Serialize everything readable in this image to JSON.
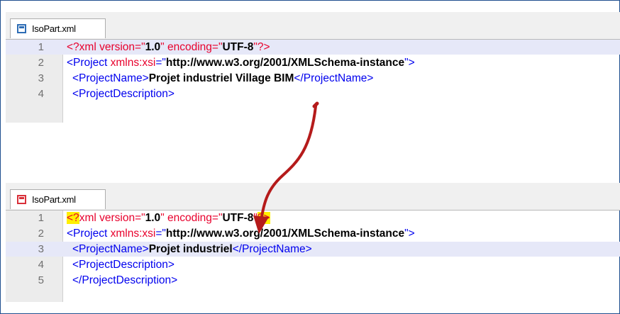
{
  "colors": {
    "tag": "#0000ee",
    "attr_value": "#000000",
    "declaration": "#e8002c",
    "highlight_marker": "#ffef00",
    "current_line": "#e6e8f8",
    "arrow": "#b51b1b",
    "saved_icon": "#2e6db5",
    "modified_icon": "#d9303a"
  },
  "top_editor": {
    "tab": {
      "icon": "saved-file-icon",
      "label": "IsoPart.xml"
    },
    "lines": [
      {
        "num": "1",
        "p1": "<?xml version=\"",
        "v1": "1.0",
        "p2": "\" encoding=\"",
        "v2": "UTF-8",
        "p3": "\"?>"
      },
      {
        "num": "2",
        "t1": "<Project ",
        "a1": "xmlns:xsi",
        "t2": "=\"",
        "v1": "http://www.w3.org/2001/XMLSchema-instance",
        "t3": "\">"
      },
      {
        "num": "3",
        "t1": "<ProjectName>",
        "text": "Projet industriel Village BIM",
        "t2": "</ProjectName>"
      },
      {
        "num": "4",
        "t1": "<ProjectDescription>"
      }
    ]
  },
  "bottom_editor": {
    "tab": {
      "icon": "modified-file-icon",
      "label": "IsoPart.xml"
    },
    "lines": [
      {
        "num": "1",
        "h1": "<?",
        "p1": "xml version=\"",
        "v1": "1.0",
        "p2": "\" encoding=\"",
        "v2": "UTF-8",
        "p3": "\"",
        "h2": "?>"
      },
      {
        "num": "2",
        "t1": "<Project ",
        "a1": "xmlns:xsi",
        "t2": "=\"",
        "v1": "http://www.w3.org/2001/XMLSchema-instance",
        "t3": "\">"
      },
      {
        "num": "3",
        "t1": "<ProjectName>",
        "text": "Projet industriel",
        "t2": "</ProjectName>"
      },
      {
        "num": "4",
        "t1": "<ProjectDescription>"
      },
      {
        "num": "5",
        "t1": "</ProjectDescription>"
      }
    ]
  }
}
